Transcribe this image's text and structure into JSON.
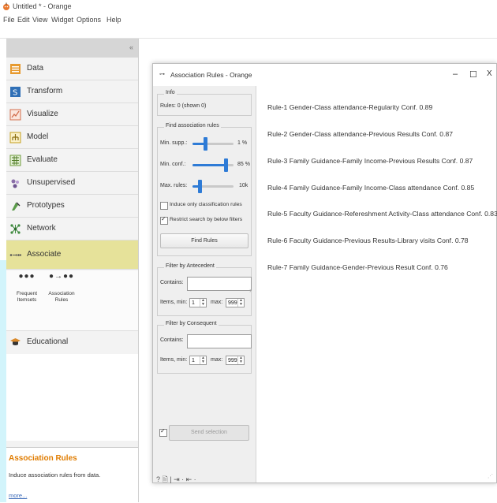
{
  "window": {
    "title": "Untitled * - Orange"
  },
  "menu": [
    "File",
    "Edit",
    "View",
    "Widget",
    "Options",
    "Help"
  ],
  "panel": {
    "collapse_glyph": "«",
    "categories": [
      {
        "label": "Data",
        "icon": "data-icon",
        "color": "#e79a2f"
      },
      {
        "label": "Transform",
        "icon": "transform-icon",
        "color": "#2f6fb6"
      },
      {
        "label": "Visualize",
        "icon": "visualize-icon",
        "color": "#d36f4e"
      },
      {
        "label": "Model",
        "icon": "model-icon",
        "color": "#c5a01f"
      },
      {
        "label": "Evaluate",
        "icon": "evaluate-icon",
        "color": "#6f9b3d"
      },
      {
        "label": "Unsupervised",
        "icon": "unsupervised-icon",
        "color": "#8a6fa8"
      },
      {
        "label": "Prototypes",
        "icon": "prototypes-icon",
        "color": "#5b9b4a"
      },
      {
        "label": "Network",
        "icon": "network-icon",
        "color": "#3e8a3e"
      },
      {
        "label": "Associate",
        "icon": "associate-icon",
        "color": "#555555"
      }
    ],
    "associate_widgets": [
      {
        "glyph": "●●●",
        "label_1": "Frequent",
        "label_2": "Itemsets"
      },
      {
        "glyph": "●→●●",
        "label_1": "Association",
        "label_2": "Rules"
      }
    ],
    "educational": {
      "label": "Educational",
      "icon": "graduation-cap-icon"
    },
    "help": {
      "title": "Association Rules",
      "description": "Induce association rules from data.",
      "more": "more..."
    }
  },
  "dialog": {
    "title_icon": "⊶",
    "title": "Association Rules - Orange",
    "win_buttons": [
      "–",
      "☐",
      "X"
    ],
    "info": {
      "title": "Info",
      "rules_text": "Rules: 0 (shown 0)"
    },
    "find": {
      "title": "Find association rules",
      "min_supp": {
        "label": "Min. supp.:",
        "value": "1 %",
        "level": 0.3
      },
      "min_conf": {
        "label": "Min. conf.:",
        "value": "85 %",
        "level": 0.85
      },
      "max_rules": {
        "label": "Max. rules:",
        "value": "10k",
        "level": 0.15
      },
      "induce_only": {
        "label": "Induce only classification rules",
        "checked": false
      },
      "restrict": {
        "label": "Restrict search by below filters",
        "checked": true
      },
      "button": "Find Rules"
    },
    "antecedent": {
      "title": "Filter by Antecedent",
      "contains_label": "Contains:",
      "contains_value": "",
      "items_min_label": "Items, min:",
      "items_min": "1",
      "items_max_label": "max:",
      "items_max": "999"
    },
    "consequent": {
      "title": "Filter by Consequent",
      "contains_label": "Contains:",
      "contains_value": "",
      "items_min_label": "Items, min:",
      "items_min": "1",
      "items_max_label": "max:",
      "items_max": "999"
    },
    "send": {
      "checked": true,
      "label": "Send selection"
    },
    "status_icons": "? 🗎 | ⇥ · ⇤ ·",
    "split_arrow": "›",
    "rules": [
      "Rule-1 Gender-Class attendance-Regularity  Conf. 0.89",
      "Rule-2 Gender-Class attendance-Previous Results  Conf. 0.87",
      "Rule-3 Family Guidance-Family Income-Previous Results  Conf. 0.87",
      "Rule-4 Family Guidance-Family Income-Class attendance  Conf. 0.85",
      "Rule-5 Faculty Guidance-Refereshment Activity-Class attendance  Conf. 0.83",
      "Rule-6 Faculty Guidance-Previous Results-Library visits  Conf. 0.78",
      "Rule-7 Family Guidance-Gender-Previous Result  Conf. 0.76"
    ]
  }
}
